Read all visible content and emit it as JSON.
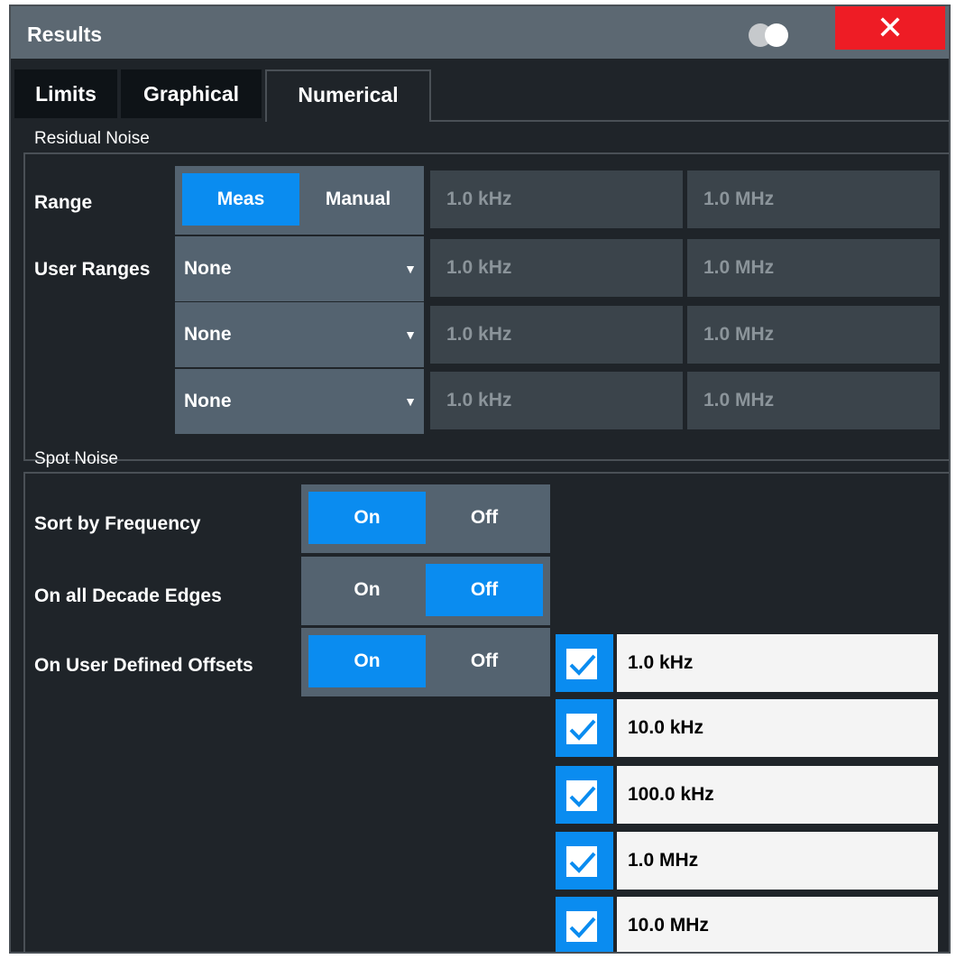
{
  "window": {
    "title": "Results",
    "close_glyph": "✕"
  },
  "tabs": [
    {
      "label": "Limits",
      "active": false
    },
    {
      "label": "Graphical",
      "active": false
    },
    {
      "label": "Numerical",
      "active": true
    }
  ],
  "residual_noise": {
    "title": "Residual Noise",
    "range": {
      "label": "Range",
      "options": [
        "Meas",
        "Manual"
      ],
      "selected": "Meas",
      "start": "1.0 kHz",
      "stop": "1.0 MHz"
    },
    "user_ranges": {
      "label": "User Ranges",
      "rows": [
        {
          "value": "None",
          "start": "1.0 kHz",
          "stop": "1.0 MHz"
        },
        {
          "value": "None",
          "start": "1.0 kHz",
          "stop": "1.0 MHz"
        },
        {
          "value": "None",
          "start": "1.0 kHz",
          "stop": "1.0 MHz"
        }
      ]
    }
  },
  "spot_noise": {
    "title": "Spot Noise",
    "sort_by_frequency": {
      "label": "Sort by Frequency",
      "on": "On",
      "off": "Off",
      "selected": "On"
    },
    "on_all_decade_edges": {
      "label": "On all Decade Edges",
      "on": "On",
      "off": "Off",
      "selected": "Off"
    },
    "on_user_defined_offsets": {
      "label": "On User Defined Offsets",
      "on": "On",
      "off": "Off",
      "selected": "On"
    },
    "offsets": [
      {
        "checked": true,
        "value": "1.0 kHz"
      },
      {
        "checked": true,
        "value": "10.0 kHz"
      },
      {
        "checked": true,
        "value": "100.0 kHz"
      },
      {
        "checked": true,
        "value": "1.0 MHz"
      },
      {
        "checked": true,
        "value": "10.0 MHz"
      }
    ]
  },
  "colors": {
    "accent": "#0a8cf0",
    "close": "#ee1c25",
    "title_bar": "#5c6872",
    "background": "#1f2429"
  },
  "icons": {
    "theme_toggle": "toggle-circles-icon",
    "close": "close-icon",
    "dropdown": "chevron-down-icon",
    "checkbox": "checkmark-icon"
  }
}
